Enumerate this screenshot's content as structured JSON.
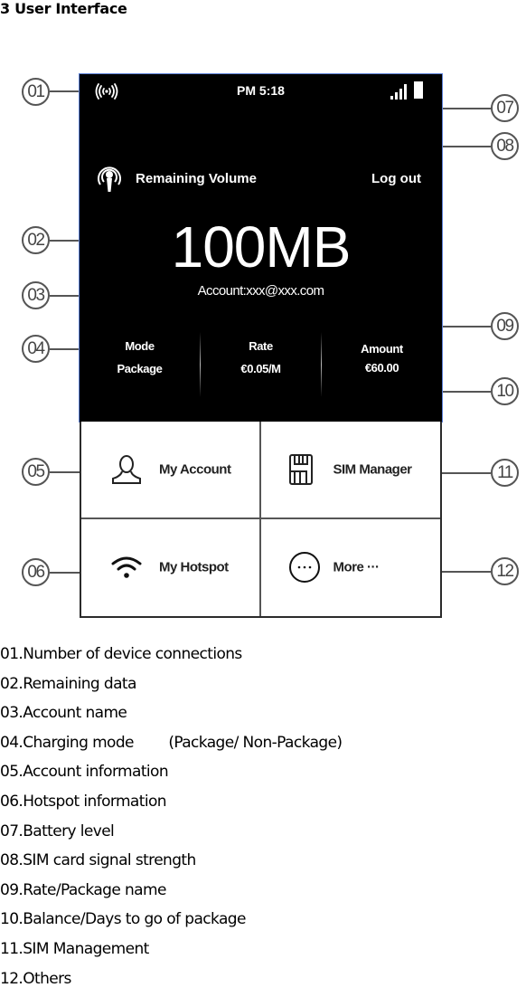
{
  "heading": "3 User Interface",
  "status_bar": {
    "time": "PM 5:18",
    "connections_icon": "device-connections-icon",
    "signal_icon": "signal-strength-icon",
    "battery_icon": "battery-icon"
  },
  "header": {
    "volume_icon": "remaining-volume-icon",
    "volume_label": "Remaining Volume",
    "logout_label": "Log out"
  },
  "main": {
    "remaining_data": "100MB",
    "account": "Account:xxx@xxx.com"
  },
  "stats": [
    {
      "key": "Mode",
      "value": "Package"
    },
    {
      "key": "Rate",
      "value": "€0.05/M"
    },
    {
      "key": "Amount",
      "value": "€60.00"
    }
  ],
  "menu": [
    {
      "label": "My Account",
      "icon": "user-icon"
    },
    {
      "label": "SIM Manager",
      "icon": "sim-card-icon"
    },
    {
      "label": "My Hotspot",
      "icon": "wifi-icon"
    },
    {
      "label": "More ···",
      "icon": "more-icon"
    }
  ],
  "callouts": [
    "01",
    "02",
    "03",
    "04",
    "05",
    "06",
    "07",
    "08",
    "09",
    "10",
    "11",
    "12"
  ],
  "colors": {
    "screen_bg": "#000000",
    "screen_border": "#5b7fd6",
    "grid_border": "#2b2b2b"
  },
  "legend": [
    "01.Number of device connections",
    "02.Remaining data",
    "03.Account name",
    "04.Charging mode        (Package/ Non-Package)",
    "05.Account information",
    "06.Hotspot information",
    "07.Battery level",
    "08.SIM card signal strength",
    "09.Rate/Package name",
    "10.Balance/Days to go of package",
    "11.SIM Management",
    "12.Others"
  ]
}
